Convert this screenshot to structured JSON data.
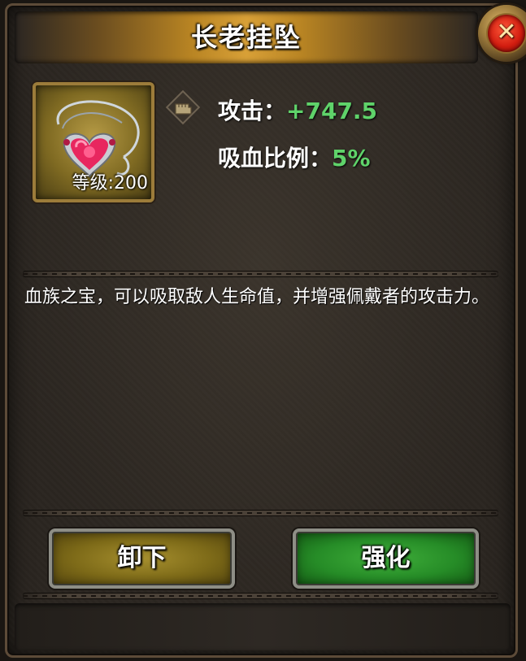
{
  "dialog": {
    "title": "长老挂坠"
  },
  "item": {
    "icon": "heart-pendant-icon",
    "level_text": "等级:200"
  },
  "stat_type_icon": "fist-icon",
  "stats": [
    {
      "label": "攻击：",
      "value": "+747.5"
    },
    {
      "label": "吸血比例：",
      "value": "5%"
    }
  ],
  "description": "血族之宝，可以吸取敌人生命值，并增强佩戴者的攻击力。",
  "buttons": {
    "unequip_label": "卸下",
    "enhance_label": "强化"
  },
  "colors": {
    "stat_value": "#5fd36a",
    "title_gold": "#d8a037",
    "close_red": "#d21d10",
    "enhance_green": "#268c27",
    "unequip_olive": "#7d6a18"
  }
}
